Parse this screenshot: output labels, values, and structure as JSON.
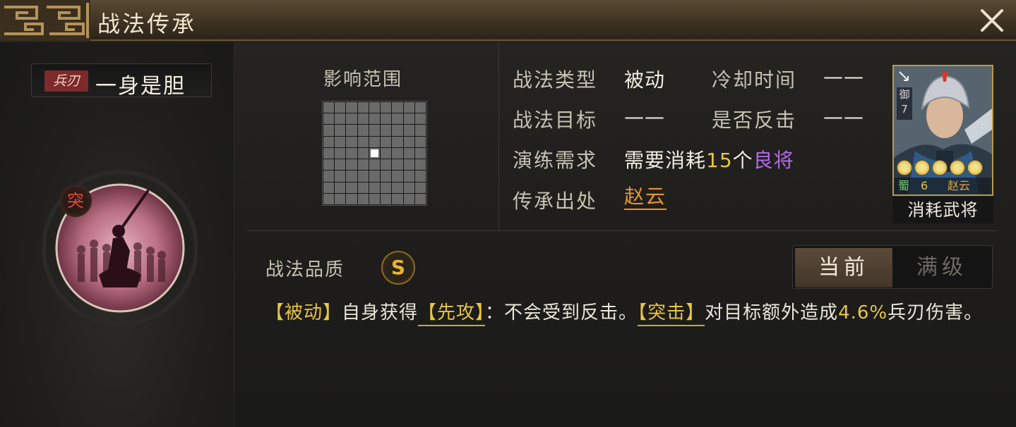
{
  "window": {
    "title": "战法传承"
  },
  "skill": {
    "troop_tag": "兵刃",
    "name": "一身是胆",
    "icon_badge": "突"
  },
  "range": {
    "label": "影响范围",
    "grid_size": 9,
    "center_index": 40
  },
  "info": {
    "type_label": "战法类型",
    "type_value": "被动",
    "cooldown_label": "冷却时间",
    "cooldown_value": "——",
    "target_label": "战法目标",
    "target_value": "——",
    "counter_label": "是否反击",
    "counter_value": "——",
    "drill_label": "演练需求",
    "drill_prefix": "需要消耗",
    "drill_count": "15",
    "drill_unit": "个",
    "drill_grade": "良将",
    "origin_label": "传承出处",
    "origin_value": "赵云"
  },
  "general_card": {
    "side_label": "御",
    "side_num": "7",
    "stars": 5,
    "faction": "蜀",
    "cost": "6",
    "name": "赵云",
    "consume_label": "消耗武将"
  },
  "quality": {
    "label": "战法品质",
    "grade": "S"
  },
  "tabs": {
    "current": "当前",
    "max": "满级"
  },
  "description": {
    "p1": "【被动】",
    "p2": "自身获得",
    "p3": "【先攻】",
    "p4": "：不会受到反击。",
    "p5": "【突击】",
    "p6": "对目标额外造成",
    "p7": "4.6%",
    "p8": "兵刃伤害。"
  },
  "colors": {
    "accent_gold": "#e8c641",
    "origin_orange": "#e9962d",
    "grade_purple": "#b56be8",
    "tag_red": "#7d2a2a"
  }
}
